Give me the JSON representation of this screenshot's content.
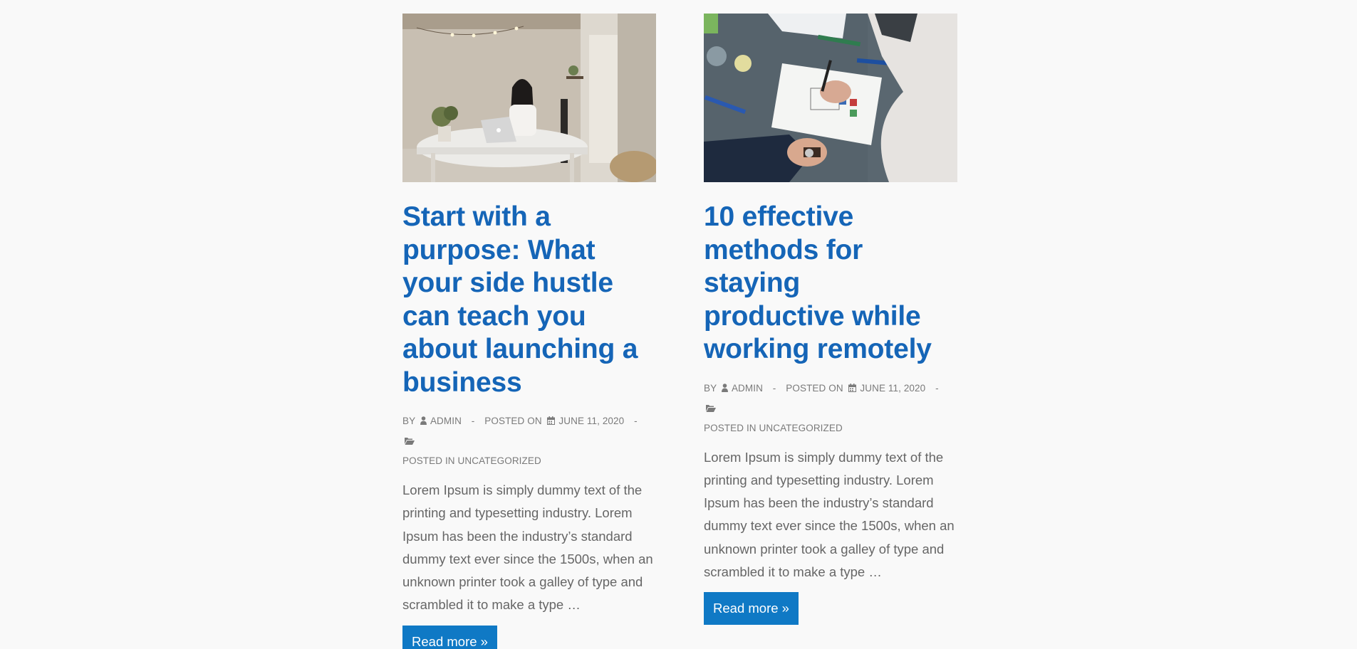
{
  "posts": [
    {
      "title": "Start with a purpose: What your side hustle can teach you about launching a business",
      "by_label": "By",
      "author": "admin",
      "posted_on_label": "Posted on",
      "date": "June 11, 2020",
      "separator": "-",
      "posted_in_label": "Posted in",
      "category": "Uncategorized",
      "excerpt": "Lorem Ipsum is simply dummy text of the printing and typesetting industry. Lorem Ipsum has been the industry’s standard dummy text ever since the 1500s, when an unknown printer took a galley of type and scrambled it to make a type …",
      "read_more": "Read more »",
      "image_icon": "woman-with-laptop-photo"
    },
    {
      "title": "10 effective methods for staying productive while working remotely",
      "by_label": "By",
      "author": "admin",
      "posted_on_label": "Posted on",
      "date": "June 11, 2020",
      "separator": "-",
      "posted_in_label": "Posted in",
      "category": "Uncategorized",
      "excerpt": "Lorem Ipsum is simply dummy text of the printing and typesetting industry. Lorem Ipsum has been the industry’s standard dummy text ever since the 1500s, when an unknown printer took a galley of type and scrambled it to make a type …",
      "read_more": "Read more »",
      "image_icon": "hands-sketching-photo"
    }
  ],
  "colors": {
    "background": "#f9f9f9",
    "title": "#1565b7",
    "meta": "#7a7a7a",
    "text": "#666666",
    "button": "#0f79c5",
    "button_text": "#ffffff"
  }
}
